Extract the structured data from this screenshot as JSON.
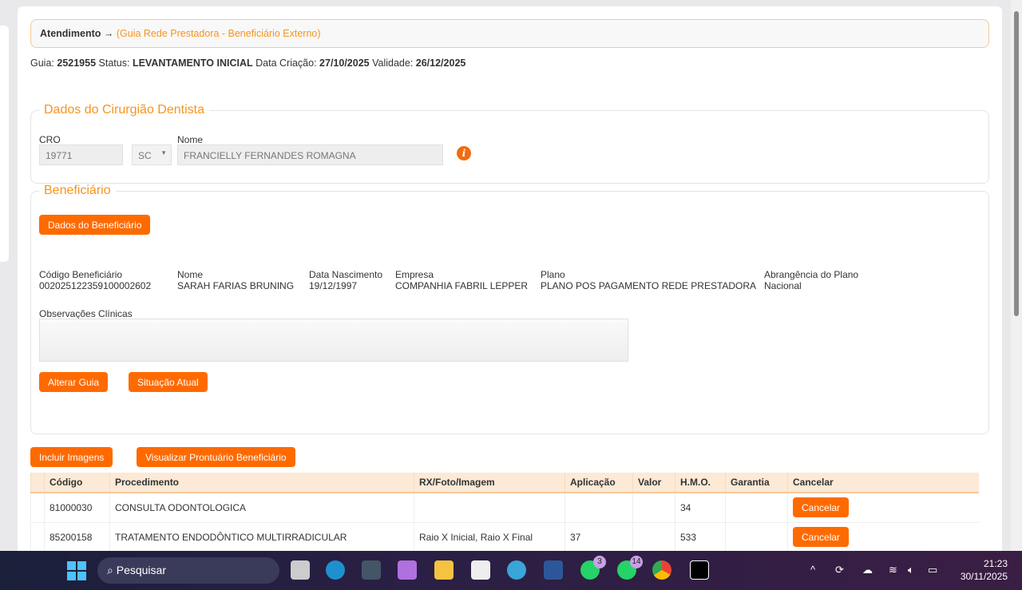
{
  "breadcrumb": {
    "root": "Atendimento",
    "arrow": "→",
    "sub": "(Guia Rede Prestadora - Beneficiário Externo)"
  },
  "guide": {
    "guia_label": "Guia:",
    "guia": "2521955",
    "status_label": "Status:",
    "status": "LEVANTAMENTO INICIAL",
    "created_label": "Data Criação:",
    "created": "27/10/2025",
    "validity_label": "Validade:",
    "validity": "26/12/2025"
  },
  "dentist": {
    "legend": "Dados do Cirurgião Dentista",
    "cro_label": "CRO",
    "cro": "19771",
    "uf": "SC",
    "name_label": "Nome",
    "name": "FRANCIELLY FERNANDES ROMAGNA",
    "info_icon": "i"
  },
  "beneficiary": {
    "legend": "Beneficiário",
    "data_button": "Dados do Beneficiário",
    "fields": [
      {
        "label": "Código Beneficiário",
        "value": "002025122359100002602"
      },
      {
        "label": "Nome",
        "value": "SARAH FARIAS BRUNING"
      },
      {
        "label": "Data Nascimento",
        "value": "19/12/1997"
      },
      {
        "label": "Empresa",
        "value": "COMPANHIA FABRIL LEPPER"
      },
      {
        "label": "Plano",
        "value": "PLANO POS PAGAMENTO REDE PRESTADORA"
      },
      {
        "label": "Abrangência do Plano",
        "value": "Nacional"
      }
    ],
    "obs_label": "Observações Clínicas",
    "obs_value": "",
    "alter_button": "Alterar Guia",
    "status_button": "Situação Atual"
  },
  "actions": {
    "include_images": "Incluir Imagens",
    "view_records": "Visualizar Prontuário Beneficiário"
  },
  "table": {
    "headers": [
      "",
      "Código",
      "Procedimento",
      "RX/Foto/Imagem",
      "Aplicação",
      "Valor",
      "H.M.O.",
      "Garantia",
      "Cancelar"
    ],
    "rows": [
      {
        "codigo": "81000030",
        "procedimento": "CONSULTA ODONTOLOGICA",
        "rx": "",
        "aplicacao": "",
        "valor": "",
        "hmo": "34",
        "garantia": "",
        "cancel": "Cancelar"
      },
      {
        "codigo": "85200158",
        "procedimento": "TRATAMENTO ENDODÔNTICO MULTIRRADICULAR",
        "rx": "Raio X Inicial, Raio X Final",
        "aplicacao": "37",
        "valor": "",
        "hmo": "533",
        "garantia": "",
        "cancel": "Cancelar"
      }
    ]
  },
  "taskbar": {
    "search": "Pesquisar",
    "whatsapp_badge_1": "3",
    "whatsapp_badge_2": "14",
    "time": "21:23",
    "date": "30/11/2025"
  },
  "colors": {
    "accent": "#ff6a00",
    "legend": "#f7941d"
  }
}
